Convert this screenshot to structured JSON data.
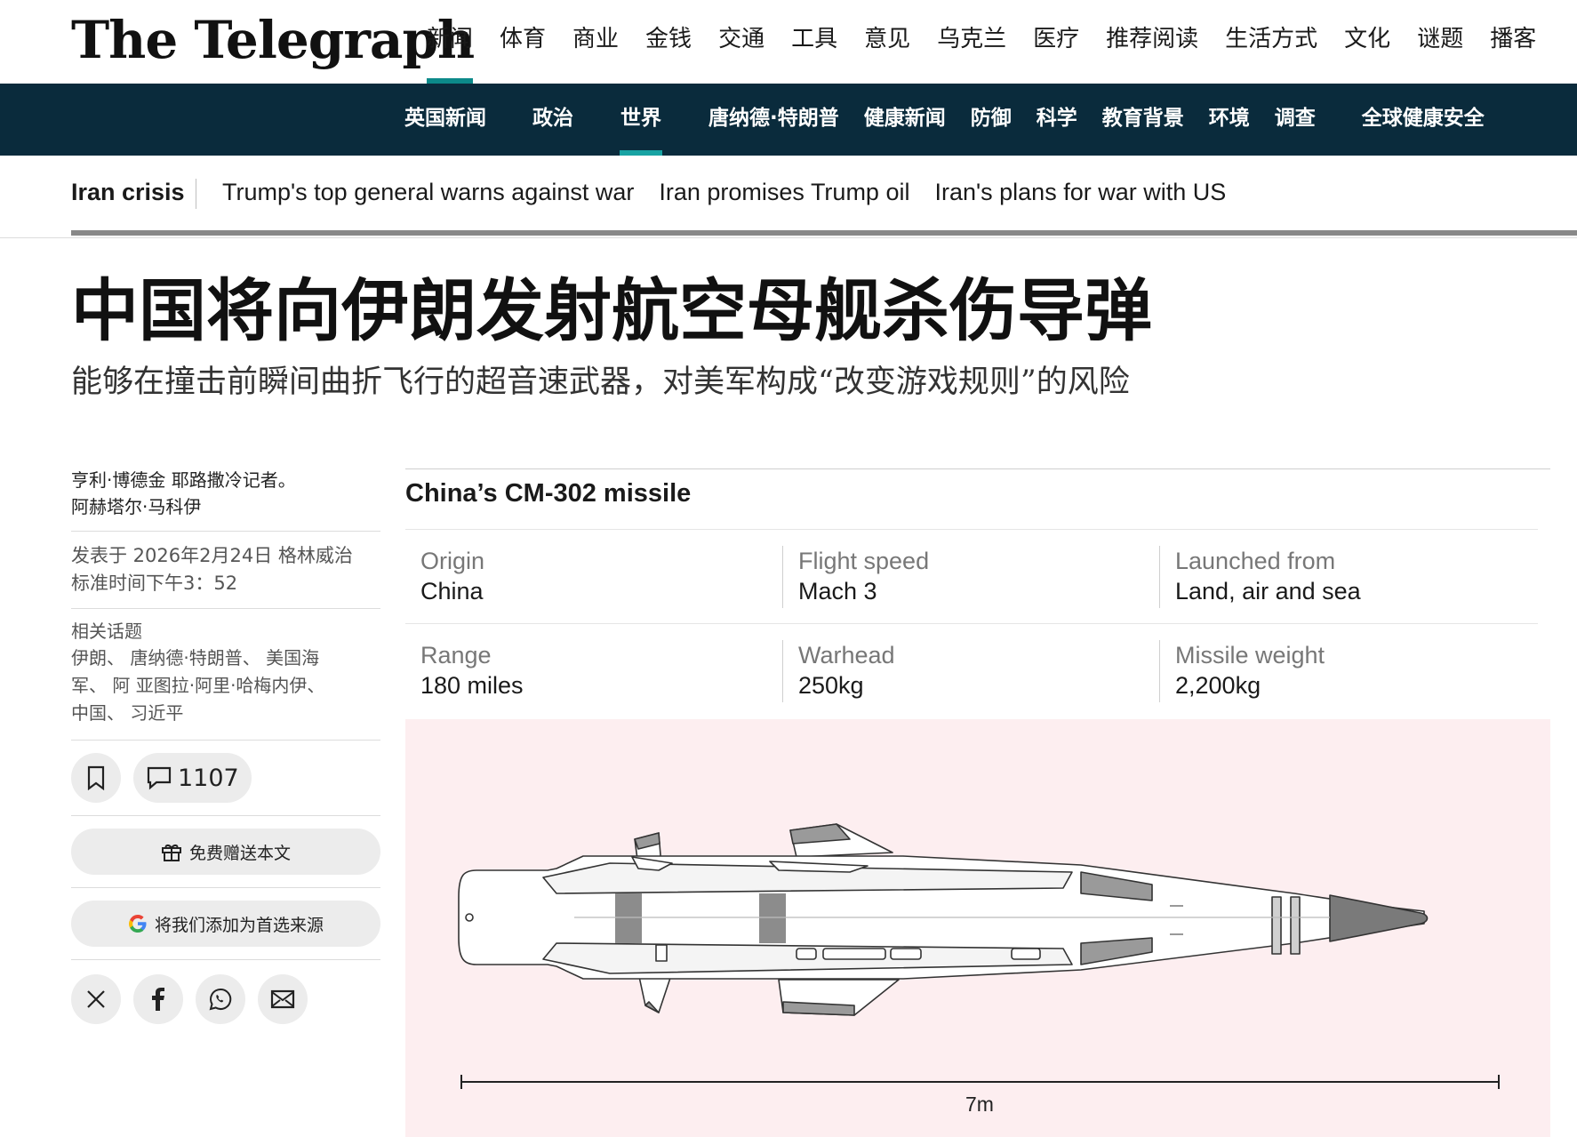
{
  "logo": "The Telegraph",
  "top_nav": [
    "新闻",
    "体育",
    "商业",
    "金钱",
    "交通",
    "工具",
    "意见",
    "乌克兰",
    "医疗",
    "推荐阅读",
    "生活方式",
    "文化",
    "谜题",
    "播客"
  ],
  "top_nav_active": 0,
  "section_nav": [
    "英国新闻",
    "政治",
    "世界",
    "唐纳德·特朗普",
    "健康新闻",
    "防御",
    "科学",
    "教育背景",
    "环境",
    "调查",
    "全球健康安全"
  ],
  "section_nav_active": 2,
  "topic_bar": {
    "label": "Iran crisis",
    "links": [
      "Trump's top general warns against war",
      "Iran promises Trump oil",
      "Iran's plans for war with US"
    ]
  },
  "article": {
    "headline": "中国将向伊朗发射航空母舰杀伤导弹",
    "standfirst": "能够在撞击前瞬间曲折飞行的超音速武器，对美军构成“改变游戏规则”的风险",
    "byline_line1": "亨利·博德金 耶路撒冷记者。",
    "byline_line2": "阿赫塔尔·马科伊",
    "published_line1": "发表于 2026年2月24日 格林威治",
    "published_line2": "标准时间下午3：52",
    "related_label": "相关话题",
    "related_line1": "伊朗、 唐纳德·特朗普、 美国海",
    "related_line2": "军、 阿 亚图拉·阿里·哈梅内伊、",
    "related_line3": "中国、 习近平",
    "comment_count": "1107",
    "gift_label": "免费赠送本文",
    "google_label": "将我们添加为首选来源"
  },
  "infographic": {
    "title": "China’s CM-302 missile",
    "specs_row1": [
      {
        "label": "Origin",
        "value": "China"
      },
      {
        "label": "Flight speed",
        "value": "Mach 3"
      },
      {
        "label": "Launched from",
        "value": "Land, air and sea"
      }
    ],
    "specs_row2": [
      {
        "label": "Range",
        "value": "180 miles"
      },
      {
        "label": "Warhead",
        "value": "250kg"
      },
      {
        "label": "Missile weight",
        "value": "2,200kg"
      }
    ],
    "scale_label": "7m",
    "background": "#fdeef0"
  },
  "colors": {
    "section_bar": "#0a2b3c",
    "accent": "#0c8a8a"
  }
}
